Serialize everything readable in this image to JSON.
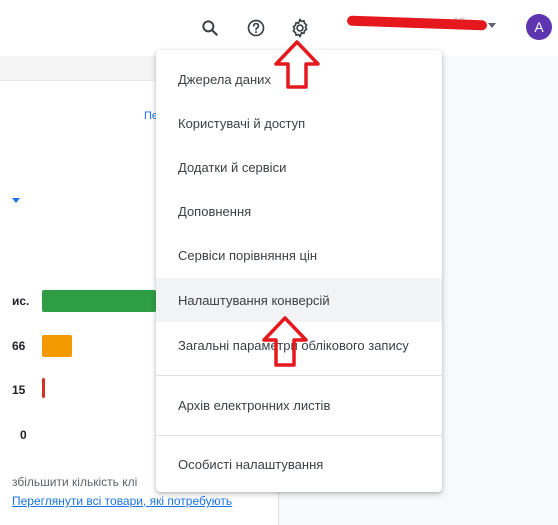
{
  "header": {
    "avatar_letter": "A",
    "account_faint": "18...",
    "icons": {
      "search": "search-icon",
      "help": "help-icon",
      "settings": "gear-icon"
    }
  },
  "background": {
    "link_fragment": "Пе",
    "rows": [
      {
        "label": "ис."
      },
      {
        "label": "66"
      },
      {
        "label": "15"
      },
      {
        "label": "0"
      }
    ],
    "footer_text": "збільшити кількість клі",
    "footer_link": "Переглянути всі товари, які потребують"
  },
  "menu": {
    "items": [
      "Джерела даних",
      "Користувачі й доступ",
      "Додатки й сервіси",
      "Доповнення",
      "Сервіси порівняння цін",
      "Налаштування конверсій",
      "Загальні параметри облікового запису",
      "Архів електронних листів",
      "Особисті налаштування"
    ]
  },
  "colors": {
    "accent": "#1a73e8",
    "annotation_red": "#e5191d",
    "avatar": "#5e35b1",
    "green_bar": "#2e9d43",
    "orange_bar": "#f29900"
  }
}
